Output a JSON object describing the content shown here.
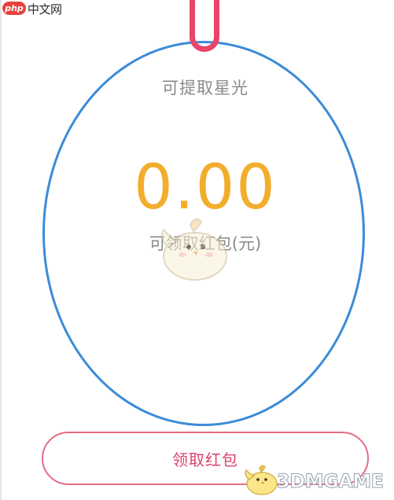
{
  "watermark": {
    "php_badge": "php",
    "php_site": "中文网",
    "site_3dm": "3DMGAME"
  },
  "wallet": {
    "stars_label": "可提取星光",
    "amount": "0.00",
    "redpacket_label": "可领取红包(元)",
    "claim_button": "领取红包"
  },
  "colors": {
    "amount": "#f3ad2d",
    "accent_pink": "#d8456b",
    "annotation_blue": "#3b8bd8",
    "annotation_red": "#e9446a"
  },
  "icons": [
    "chick-mascot-icon"
  ]
}
